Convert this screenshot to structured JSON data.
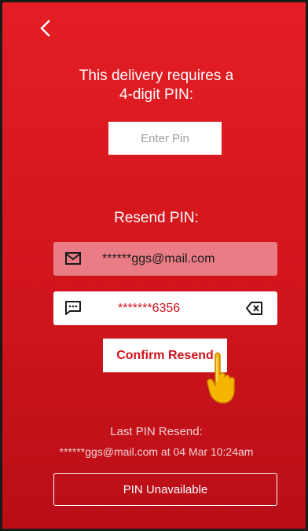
{
  "header": {
    "back_icon": "chevron-left-icon"
  },
  "pin_prompt": {
    "title": "This delivery requires a\n4-digit PIN:",
    "input_placeholder": "Enter Pin",
    "input_value": ""
  },
  "resend": {
    "label": "Resend PIN:",
    "options": [
      {
        "type": "email",
        "icon": "envelope-icon",
        "value": "******ggs@mail.com",
        "selected": true
      },
      {
        "type": "sms",
        "icon": "message-icon",
        "value": "*******6356",
        "clear_icon": "backspace-icon",
        "selected": false
      }
    ],
    "confirm_label": "Confirm Resend"
  },
  "last_resend": {
    "label": "Last PIN Resend:",
    "detail": "******ggs@mail.com at 04 Mar 10:24am"
  },
  "footer": {
    "unavailable_label": "PIN Unavailable"
  },
  "colors": {
    "background_top": "#e31e24",
    "background_bottom": "#b80e17",
    "selected_option": "#ea7c86",
    "accent_text": "#d1141c",
    "muted_text": "#f3d0d2"
  }
}
